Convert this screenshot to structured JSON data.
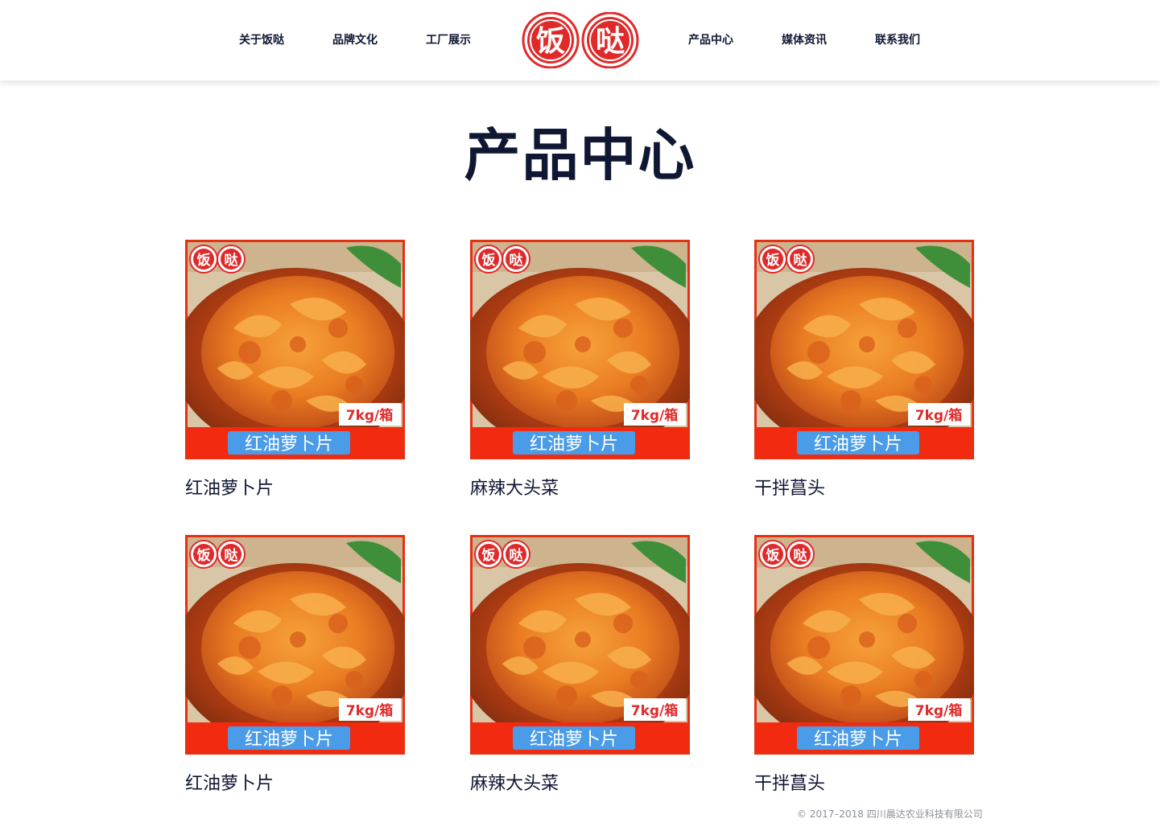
{
  "nav": {
    "left": [
      "关于饭哒",
      "品牌文化",
      "工厂展示"
    ],
    "right": [
      "产品中心",
      "媒体资讯",
      "联系我们"
    ]
  },
  "logo": {
    "chars": [
      "饭",
      "哒"
    ],
    "color": "#e02a2a"
  },
  "title": "产品中心",
  "product_image": {
    "badge": "7kg/箱",
    "banner": "红油萝卜片",
    "logo_chars": [
      "饭",
      "哒"
    ]
  },
  "products": [
    {
      "name": "红油萝卜片"
    },
    {
      "name": "麻辣大头菜"
    },
    {
      "name": "干拌菖头"
    },
    {
      "name": "红油萝卜片"
    },
    {
      "name": "麻辣大头菜"
    },
    {
      "name": "干拌菖头"
    }
  ],
  "footer": "© 2017–2018 四川晨达农业科技有限公司",
  "colors": {
    "brand_red": "#e02a2a",
    "text_navy": "#0f1733",
    "banner_blue": "#4a9be8"
  }
}
